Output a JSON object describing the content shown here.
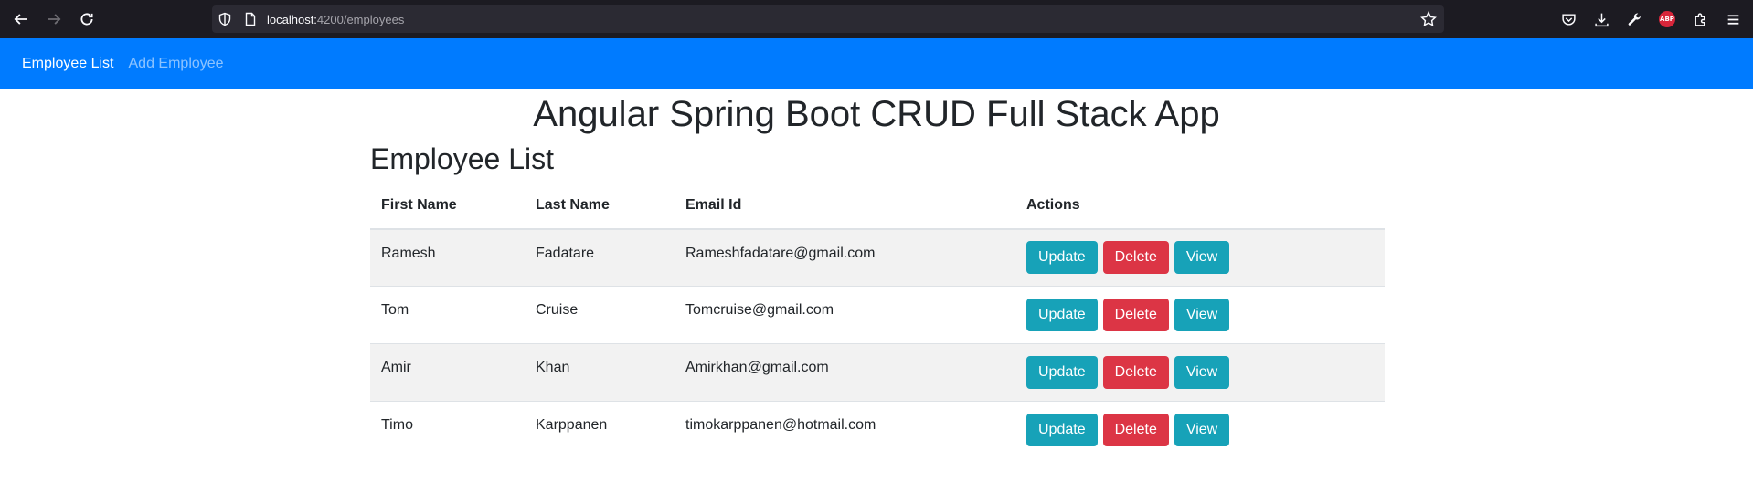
{
  "browser": {
    "url_host": "localhost:",
    "url_path": "4200/employees",
    "icons": [
      "back-arrow-icon",
      "forward-arrow-icon",
      "reload-icon",
      "shield-icon",
      "page-icon",
      "star-icon",
      "pocket-icon",
      "download-icon",
      "wrench-icon",
      "abp-icon",
      "extensions-icon",
      "menu-icon"
    ],
    "abp_label": "ABP"
  },
  "navbar": {
    "color": "#007bff",
    "links": [
      {
        "label": "Employee List",
        "active": true
      },
      {
        "label": "Add Employee",
        "active": false
      }
    ]
  },
  "page": {
    "title": "Angular Spring Boot CRUD Full Stack App",
    "section_title": "Employee List"
  },
  "table": {
    "headers": [
      "First Name",
      "Last Name",
      "Email Id",
      "Actions"
    ],
    "rows": [
      {
        "first": "Ramesh",
        "last": "Fadatare",
        "email": "Rameshfadatare@gmail.com"
      },
      {
        "first": "Tom",
        "last": "Cruise",
        "email": "Tomcruise@gmail.com"
      },
      {
        "first": "Amir",
        "last": "Khan",
        "email": "Amirkhan@gmail.com"
      },
      {
        "first": "Timo",
        "last": "Karppanen",
        "email": "timokarppanen@hotmail.com"
      }
    ],
    "actions": {
      "update": "Update",
      "delete": "Delete",
      "view": "View"
    },
    "colors": {
      "info": "#17a2b8",
      "danger": "#dc3545"
    }
  }
}
